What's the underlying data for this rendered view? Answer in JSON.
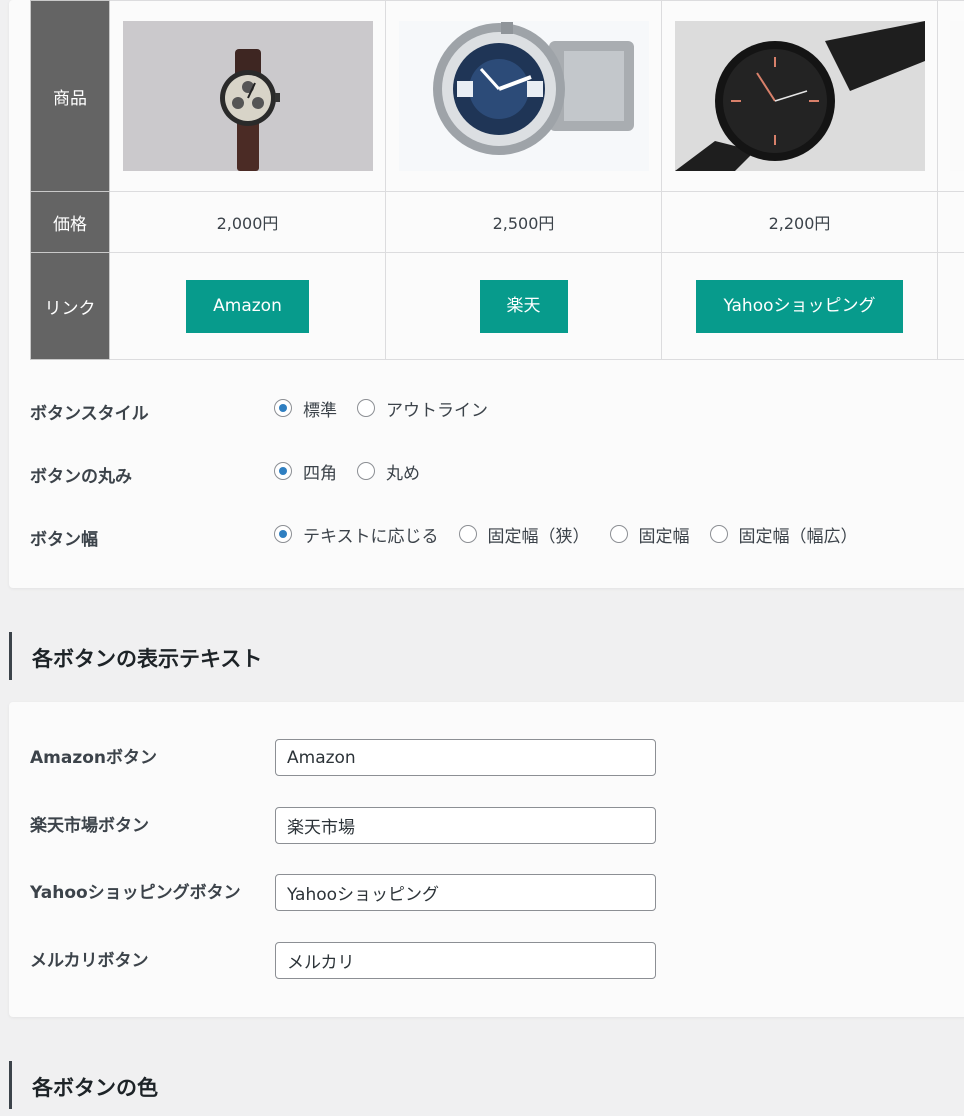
{
  "table": {
    "headers": {
      "product": "商品",
      "price": "価格",
      "link": "リンク"
    },
    "products": [
      {
        "image": "chronograph-watch-brown-strap-image",
        "price": "2,000円"
      },
      {
        "image": "steel-diver-watch-blue-dial-image",
        "price": "2,500円"
      },
      {
        "image": "black-mesh-watch-image",
        "price": "2,200円"
      }
    ],
    "links": {
      "amazon": "Amazon",
      "rakuten": "楽天",
      "yahoo": "Yahooショッピング"
    },
    "button_color": "#079b8c"
  },
  "settings": {
    "style": {
      "label": "ボタンスタイル",
      "options": [
        "標準",
        "アウトライン"
      ],
      "selected": 0
    },
    "corner": {
      "label": "ボタンの丸み",
      "options": [
        "四角",
        "丸め"
      ],
      "selected": 0
    },
    "width": {
      "label": "ボタン幅",
      "options": [
        "テキストに応じる",
        "固定幅（狭）",
        "固定幅",
        "固定幅（幅広）"
      ],
      "selected": 0
    }
  },
  "text_section": {
    "heading": "各ボタンの表示テキスト",
    "fields": {
      "amazon": {
        "label": "Amazonボタン",
        "value": "Amazon"
      },
      "rakuten": {
        "label": "楽天市場ボタン",
        "value": "楽天市場"
      },
      "yahoo": {
        "label": "Yahooショッピングボタン",
        "value": "Yahooショッピング"
      },
      "mercari": {
        "label": "メルカリボタン",
        "value": "メルカリ"
      }
    }
  },
  "color_section": {
    "heading": "各ボタンの色"
  }
}
